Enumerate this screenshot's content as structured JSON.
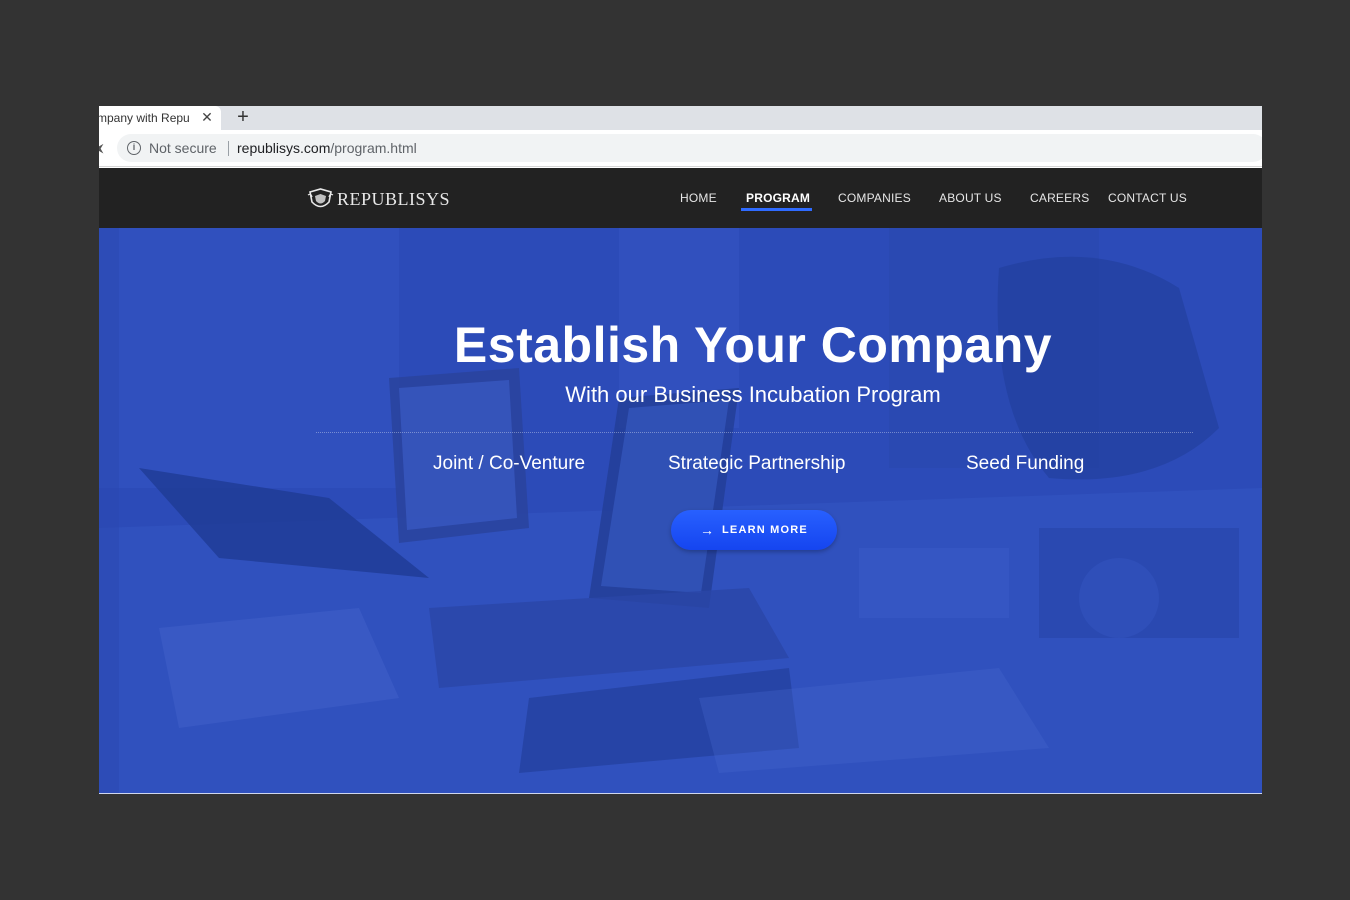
{
  "browser": {
    "tab_title": "mpany with Repu",
    "url_prefix": "Not secure",
    "url_host": "republisys.com",
    "url_path": "/program.html"
  },
  "site": {
    "brand": "REPUBLISYS",
    "nav": [
      {
        "label": "HOME",
        "active": false
      },
      {
        "label": "PROGRAM",
        "active": true
      },
      {
        "label": "COMPANIES",
        "active": false
      },
      {
        "label": "ABOUT US",
        "active": false
      },
      {
        "label": "CAREERS",
        "active": false
      },
      {
        "label": "CONTACT US",
        "active": false
      }
    ]
  },
  "hero": {
    "title": "Establish Your Company",
    "subtitle": "With our Business Incubation Program",
    "features": [
      "Joint / Co-Venture",
      "Strategic Partnership",
      "Seed Funding"
    ],
    "cta_label": "LEARN MORE"
  },
  "colors": {
    "hero_blue": "#2c49b4",
    "nav_bg": "#222222",
    "accent": "#2f6bff",
    "page_bg": "#333333"
  }
}
